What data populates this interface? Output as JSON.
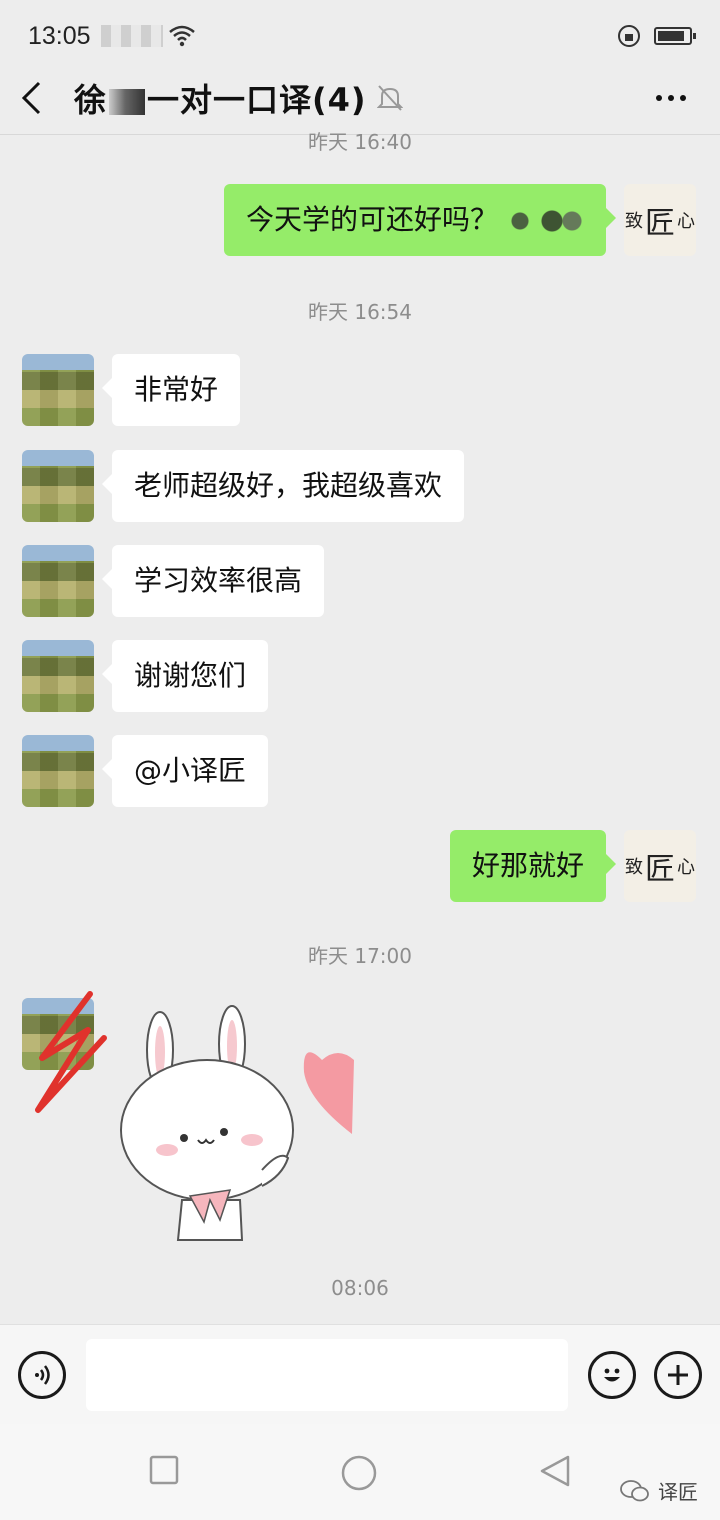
{
  "status_bar": {
    "time": "13:05"
  },
  "nav": {
    "title_prefix": "徐",
    "title_suffix": "一对一口译(4)"
  },
  "timestamps": [
    "昨天 16:40",
    "昨天 16:54",
    "昨天 17:00",
    "08:06"
  ],
  "messages": [
    {
      "side": "right",
      "text": "今天学的可还好吗？"
    },
    {
      "side": "left",
      "text": "非常好"
    },
    {
      "side": "left",
      "text": "老师超级好，我超级喜欢"
    },
    {
      "side": "left",
      "text": "学习效率很高"
    },
    {
      "side": "left",
      "text": "谢谢您们"
    },
    {
      "side": "left",
      "text": "@小译匠"
    },
    {
      "side": "right",
      "text": "好那就好"
    }
  ],
  "brand_avatar": {
    "small": "致",
    "big": "匠",
    "tail": "心"
  },
  "input": {
    "value": ""
  },
  "watermark": {
    "label": "译匠"
  },
  "colors": {
    "sent_bubble": "#95ec69",
    "received_bubble": "#ffffff",
    "background": "#ededed"
  }
}
